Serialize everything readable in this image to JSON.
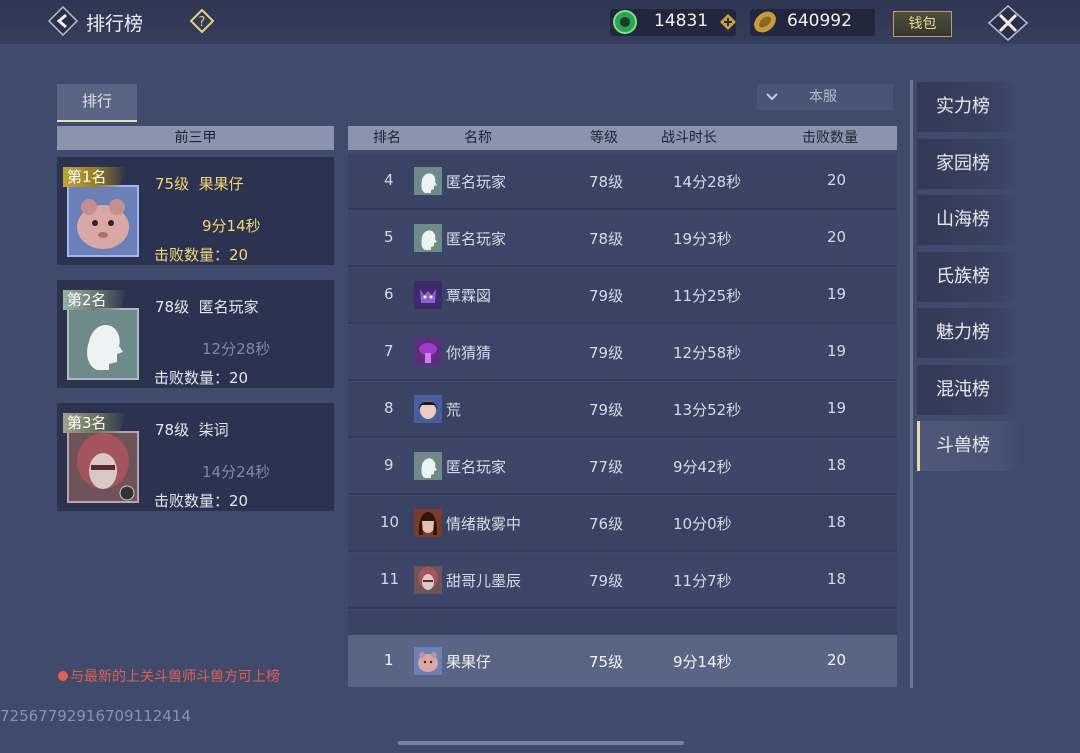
{
  "header": {
    "title": "排行榜",
    "currency1": "14831",
    "currency2": "640992",
    "wallet_label": "钱包"
  },
  "tabs": {
    "rank_tab": "排行",
    "server_select": "本服"
  },
  "top3": {
    "header": "前三甲",
    "cards": [
      {
        "rank": "第1名",
        "level": "75级",
        "name": "果果仔",
        "time": "9分14秒",
        "kills": "击败数量：20"
      },
      {
        "rank": "第2名",
        "level": "78级",
        "name": "匿名玩家",
        "time": "12分28秒",
        "kills": "击败数量：20"
      },
      {
        "rank": "第3名",
        "level": "78级",
        "name": "柒词",
        "time": "14分24秒",
        "kills": "击败数量：20"
      }
    ]
  },
  "list": {
    "columns": [
      "排名",
      "名称",
      "等级",
      "战斗时长",
      "击败数量"
    ],
    "rows": [
      {
        "rank": "4",
        "name": "匿名玩家",
        "level": "78级",
        "time": "14分28秒",
        "kills": "20"
      },
      {
        "rank": "5",
        "name": "匿名玩家",
        "level": "78级",
        "time": "19分3秒",
        "kills": "20"
      },
      {
        "rank": "6",
        "name": "覃霖図",
        "level": "79级",
        "time": "11分25秒",
        "kills": "19"
      },
      {
        "rank": "7",
        "name": "你猜猜",
        "level": "79级",
        "time": "12分58秒",
        "kills": "19"
      },
      {
        "rank": "8",
        "name": "荒",
        "level": "79级",
        "time": "13分52秒",
        "kills": "19"
      },
      {
        "rank": "9",
        "name": "匿名玩家",
        "level": "77级",
        "time": "9分42秒",
        "kills": "18"
      },
      {
        "rank": "10",
        "name": "情绪散雾中",
        "level": "76级",
        "time": "10分0秒",
        "kills": "18"
      },
      {
        "rank": "11",
        "name": "甜哥儿墨辰",
        "level": "79级",
        "time": "11分7秒",
        "kills": "18"
      }
    ],
    "my_row": {
      "rank": "1",
      "name": "果果仔",
      "level": "75级",
      "time": "9分14秒",
      "kills": "20"
    }
  },
  "side_tabs": [
    "实力榜",
    "家园榜",
    "山海榜",
    "氏族榜",
    "魅力榜",
    "混沌榜",
    "斗兽榜"
  ],
  "active_side_tab": "斗兽榜",
  "notice": "与最新的上关斗兽师斗兽方可上榜",
  "user_id": "7256779291670911241​4",
  "colors": {
    "background": "#404a6d",
    "gold_text": "#f0d872",
    "notice_red": "#e0604f",
    "active_tab_border": "#e7dca8"
  }
}
